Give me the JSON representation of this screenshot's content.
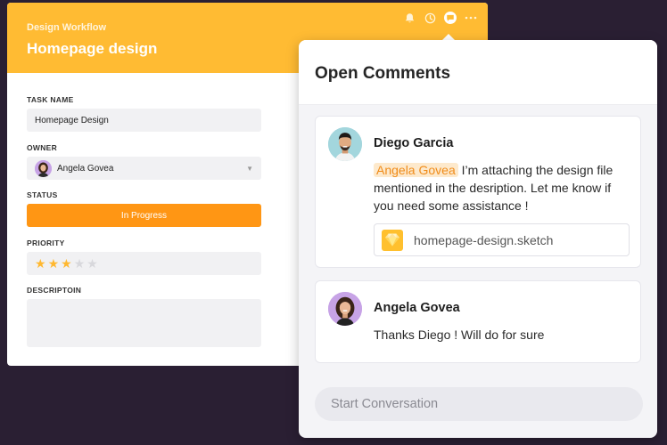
{
  "task": {
    "workflow": "Design Workflow",
    "title": "Homepage design",
    "fields": {
      "task_name_label": "TASK NAME",
      "task_name_value": "Homepage Design",
      "owner_label": "OWNER",
      "owner_value": "Angela Govea",
      "status_label": "STATUS",
      "status_value": "In Progress",
      "priority_label": "PRIORITY",
      "priority_rating": 3,
      "priority_max": 5,
      "description_label": "DESCRIPTOIN",
      "description_value": ""
    },
    "header_icons": [
      "bell-icon",
      "clock-icon",
      "comment-icon",
      "more-icon"
    ]
  },
  "comments_panel": {
    "title": "Open Comments",
    "comments": [
      {
        "author": "Diego Garcia",
        "mention": "Angela Govea",
        "text": "I’m attaching the design file mentioned in the desription. Let me know if you need some assistance !",
        "attachment": "homepage-design.sketch"
      },
      {
        "author": "Angela Govea",
        "text": "Thanks Diego ! Will do for sure"
      }
    ],
    "input_placeholder": "Start Conversation"
  },
  "colors": {
    "background": "#2a1f33",
    "header": "#ffbb33",
    "status": "#ff9614",
    "mention_text": "#f08c1a",
    "mention_bg": "#fde9cc",
    "star_on": "#ffb830"
  }
}
